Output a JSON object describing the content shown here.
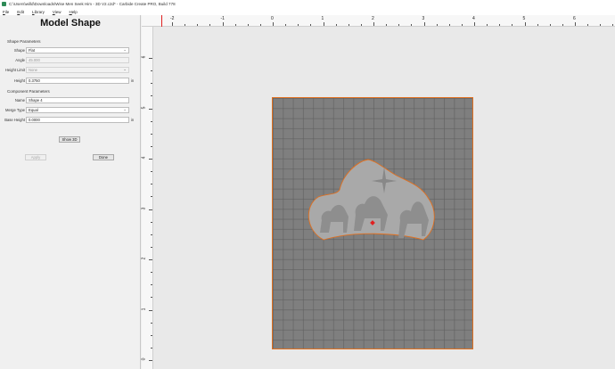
{
  "window": {
    "title": "C:\\Users\\willd\\Downloads\\Wise Men Seek Him - 3D V2.c2d* - Carbide Create PRO, Build 778"
  },
  "menu": [
    "File",
    "Edit",
    "Library",
    "View",
    "Help"
  ],
  "panel": {
    "title": "Model Shape",
    "shape_section": "Shape Parameters",
    "shape_label": "Shape",
    "shape_value": "Flat",
    "angle_label": "Angle",
    "angle_value": "45.000",
    "height_limit_label": "Height Limit",
    "height_limit_value": "None",
    "height_label": "Height",
    "height_value": "0.3750",
    "height_unit": "in",
    "component_section": "Component Parameters",
    "name_label": "Name",
    "name_value": "Shape 4",
    "merge_label": "Merge Type",
    "merge_value": "Equal",
    "base_height_label": "Base Height",
    "base_height_value": "0.0000",
    "base_height_unit": "in",
    "show3d_label": "Show 3D",
    "apply_label": "Apply",
    "done_label": "Done"
  },
  "ruler": {
    "x_labels": [
      "-2",
      "-1",
      "0",
      "1",
      "2",
      "3",
      "4",
      "5",
      "6"
    ],
    "y_labels": [
      "6",
      "5",
      "4",
      "3",
      "2",
      "1",
      "0"
    ]
  },
  "colors": {
    "stock_border": "#e07020",
    "stock_fill": "#7f7f7f",
    "origin": "#e02020"
  }
}
